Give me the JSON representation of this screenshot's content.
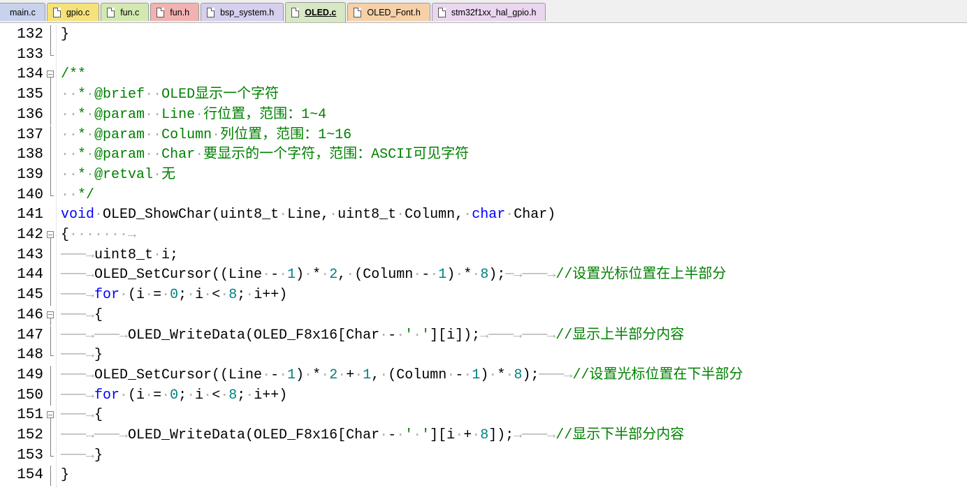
{
  "tabs": [
    {
      "label": "main.c",
      "color": "#c8d2ec"
    },
    {
      "label": "gpio.c",
      "color": "#f6e27a"
    },
    {
      "label": "fun.c",
      "color": "#d3e9b2"
    },
    {
      "label": "fun.h",
      "color": "#f2b2b2"
    },
    {
      "label": "bsp_system.h",
      "color": "#d6cfee"
    },
    {
      "label": "OLED.c",
      "color": "#d8e7c4",
      "active": true
    },
    {
      "label": "OLED_Font.h",
      "color": "#f6d0a8"
    },
    {
      "label": "stm32f1xx_hal_gpio.h",
      "color": "#ead6ee"
    }
  ],
  "colors": {
    "comment": "#008000",
    "keyword": "#0000ff",
    "number": "#008080",
    "whitespace_marker": "#b0b0b0"
  },
  "lines": [
    {
      "num": "132",
      "fold": "line",
      "tokens": [
        {
          "t": "}"
        }
      ]
    },
    {
      "num": "133",
      "fold": "end",
      "tokens": []
    },
    {
      "num": "134",
      "fold": "box",
      "tokens": [
        {
          "t": "/**",
          "c": "comment"
        }
      ]
    },
    {
      "num": "135",
      "fold": "line",
      "tokens": [
        {
          "t": "··",
          "c": "ws"
        },
        {
          "t": "*",
          "c": "comment"
        },
        {
          "t": "·",
          "c": "ws"
        },
        {
          "t": "@brief",
          "c": "comment"
        },
        {
          "t": "··",
          "c": "ws"
        },
        {
          "t": "OLED显示一个字符",
          "c": "comment"
        }
      ]
    },
    {
      "num": "136",
      "fold": "line",
      "tokens": [
        {
          "t": "··",
          "c": "ws"
        },
        {
          "t": "*",
          "c": "comment"
        },
        {
          "t": "·",
          "c": "ws"
        },
        {
          "t": "@param",
          "c": "comment"
        },
        {
          "t": "··",
          "c": "ws"
        },
        {
          "t": "Line",
          "c": "comment"
        },
        {
          "t": "·",
          "c": "ws"
        },
        {
          "t": "行位置，范围：1~4",
          "c": "comment"
        }
      ]
    },
    {
      "num": "137",
      "fold": "line",
      "tokens": [
        {
          "t": "··",
          "c": "ws"
        },
        {
          "t": "*",
          "c": "comment"
        },
        {
          "t": "·",
          "c": "ws"
        },
        {
          "t": "@param",
          "c": "comment"
        },
        {
          "t": "··",
          "c": "ws"
        },
        {
          "t": "Column",
          "c": "comment"
        },
        {
          "t": "·",
          "c": "ws"
        },
        {
          "t": "列位置，范围：1~16",
          "c": "comment"
        }
      ]
    },
    {
      "num": "138",
      "fold": "line",
      "tokens": [
        {
          "t": "··",
          "c": "ws"
        },
        {
          "t": "*",
          "c": "comment"
        },
        {
          "t": "·",
          "c": "ws"
        },
        {
          "t": "@param",
          "c": "comment"
        },
        {
          "t": "··",
          "c": "ws"
        },
        {
          "t": "Char",
          "c": "comment"
        },
        {
          "t": "·",
          "c": "ws"
        },
        {
          "t": "要显示的一个字符，范围：ASCII可见字符",
          "c": "comment"
        }
      ]
    },
    {
      "num": "139",
      "fold": "line",
      "tokens": [
        {
          "t": "··",
          "c": "ws"
        },
        {
          "t": "*",
          "c": "comment"
        },
        {
          "t": "·",
          "c": "ws"
        },
        {
          "t": "@retval",
          "c": "comment"
        },
        {
          "t": "·",
          "c": "ws"
        },
        {
          "t": "无",
          "c": "comment"
        }
      ]
    },
    {
      "num": "140",
      "fold": "end",
      "tokens": [
        {
          "t": "··",
          "c": "ws"
        },
        {
          "t": "*/",
          "c": "comment"
        }
      ]
    },
    {
      "num": "141",
      "fold": "",
      "tokens": [
        {
          "t": "void",
          "c": "kw"
        },
        {
          "t": "·",
          "c": "ws"
        },
        {
          "t": "OLED_ShowChar(uint8_t"
        },
        {
          "t": "·",
          "c": "ws"
        },
        {
          "t": "Line,"
        },
        {
          "t": "·",
          "c": "ws"
        },
        {
          "t": "uint8_t"
        },
        {
          "t": "·",
          "c": "ws"
        },
        {
          "t": "Column,"
        },
        {
          "t": "·",
          "c": "ws"
        },
        {
          "t": "char",
          "c": "kw"
        },
        {
          "t": "·",
          "c": "ws"
        },
        {
          "t": "Char)"
        }
      ]
    },
    {
      "num": "142",
      "fold": "box",
      "tokens": [
        {
          "t": "{"
        },
        {
          "t": "·······→",
          "c": "ws"
        }
      ]
    },
    {
      "num": "143",
      "fold": "line",
      "tokens": [
        {
          "t": "───→",
          "c": "ws"
        },
        {
          "t": "uint8_t"
        },
        {
          "t": "·",
          "c": "ws"
        },
        {
          "t": "i;"
        }
      ]
    },
    {
      "num": "144",
      "fold": "line",
      "tokens": [
        {
          "t": "───→",
          "c": "ws"
        },
        {
          "t": "OLED_SetCursor((Line"
        },
        {
          "t": "·",
          "c": "ws"
        },
        {
          "t": "-"
        },
        {
          "t": "·",
          "c": "ws"
        },
        {
          "t": "1",
          "c": "num"
        },
        {
          "t": ")"
        },
        {
          "t": "·",
          "c": "ws"
        },
        {
          "t": "*"
        },
        {
          "t": "·",
          "c": "ws"
        },
        {
          "t": "2",
          "c": "num"
        },
        {
          "t": ","
        },
        {
          "t": "·",
          "c": "ws"
        },
        {
          "t": "(Column"
        },
        {
          "t": "·",
          "c": "ws"
        },
        {
          "t": "-"
        },
        {
          "t": "·",
          "c": "ws"
        },
        {
          "t": "1",
          "c": "num"
        },
        {
          "t": ")"
        },
        {
          "t": "·",
          "c": "ws"
        },
        {
          "t": "*"
        },
        {
          "t": "·",
          "c": "ws"
        },
        {
          "t": "8",
          "c": "num"
        },
        {
          "t": ");"
        },
        {
          "t": "─→───→",
          "c": "ws"
        },
        {
          "t": "//设置光标位置在上半部分",
          "c": "comment"
        }
      ]
    },
    {
      "num": "145",
      "fold": "line",
      "tokens": [
        {
          "t": "───→",
          "c": "ws"
        },
        {
          "t": "for",
          "c": "kw"
        },
        {
          "t": "·",
          "c": "ws"
        },
        {
          "t": "(i"
        },
        {
          "t": "·",
          "c": "ws"
        },
        {
          "t": "="
        },
        {
          "t": "·",
          "c": "ws"
        },
        {
          "t": "0",
          "c": "num"
        },
        {
          "t": ";"
        },
        {
          "t": "·",
          "c": "ws"
        },
        {
          "t": "i"
        },
        {
          "t": "·",
          "c": "ws"
        },
        {
          "t": "<"
        },
        {
          "t": "·",
          "c": "ws"
        },
        {
          "t": "8",
          "c": "num"
        },
        {
          "t": ";"
        },
        {
          "t": "·",
          "c": "ws"
        },
        {
          "t": "i++)"
        }
      ]
    },
    {
      "num": "146",
      "fold": "box",
      "tokens": [
        {
          "t": "───→",
          "c": "ws"
        },
        {
          "t": "{"
        }
      ]
    },
    {
      "num": "147",
      "fold": "line",
      "tokens": [
        {
          "t": "───→───→",
          "c": "ws"
        },
        {
          "t": "OLED_WriteData(OLED_F8x16[Char"
        },
        {
          "t": "·",
          "c": "ws"
        },
        {
          "t": "-"
        },
        {
          "t": "·",
          "c": "ws"
        },
        {
          "t": "'",
          "c": "comment"
        },
        {
          "t": "·",
          "c": "ws"
        },
        {
          "t": "'",
          "c": "comment"
        },
        {
          "t": "][i]);"
        },
        {
          "t": "→───→───→",
          "c": "ws"
        },
        {
          "t": "//显示上半部分内容",
          "c": "comment"
        }
      ]
    },
    {
      "num": "148",
      "fold": "end",
      "tokens": [
        {
          "t": "───→",
          "c": "ws"
        },
        {
          "t": "}"
        }
      ]
    },
    {
      "num": "149",
      "fold": "line",
      "tokens": [
        {
          "t": "───→",
          "c": "ws"
        },
        {
          "t": "OLED_SetCursor((Line"
        },
        {
          "t": "·",
          "c": "ws"
        },
        {
          "t": "-"
        },
        {
          "t": "·",
          "c": "ws"
        },
        {
          "t": "1",
          "c": "num"
        },
        {
          "t": ")"
        },
        {
          "t": "·",
          "c": "ws"
        },
        {
          "t": "*"
        },
        {
          "t": "·",
          "c": "ws"
        },
        {
          "t": "2",
          "c": "num"
        },
        {
          "t": "·",
          "c": "ws"
        },
        {
          "t": "+"
        },
        {
          "t": "·",
          "c": "ws"
        },
        {
          "t": "1",
          "c": "num"
        },
        {
          "t": ","
        },
        {
          "t": "·",
          "c": "ws"
        },
        {
          "t": "(Column"
        },
        {
          "t": "·",
          "c": "ws"
        },
        {
          "t": "-"
        },
        {
          "t": "·",
          "c": "ws"
        },
        {
          "t": "1",
          "c": "num"
        },
        {
          "t": ")"
        },
        {
          "t": "·",
          "c": "ws"
        },
        {
          "t": "*"
        },
        {
          "t": "·",
          "c": "ws"
        },
        {
          "t": "8",
          "c": "num"
        },
        {
          "t": ");"
        },
        {
          "t": "───→",
          "c": "ws"
        },
        {
          "t": "//设置光标位置在下半部分",
          "c": "comment"
        }
      ]
    },
    {
      "num": "150",
      "fold": "line",
      "tokens": [
        {
          "t": "───→",
          "c": "ws"
        },
        {
          "t": "for",
          "c": "kw"
        },
        {
          "t": "·",
          "c": "ws"
        },
        {
          "t": "(i"
        },
        {
          "t": "·",
          "c": "ws"
        },
        {
          "t": "="
        },
        {
          "t": "·",
          "c": "ws"
        },
        {
          "t": "0",
          "c": "num"
        },
        {
          "t": ";"
        },
        {
          "t": "·",
          "c": "ws"
        },
        {
          "t": "i"
        },
        {
          "t": "·",
          "c": "ws"
        },
        {
          "t": "<"
        },
        {
          "t": "·",
          "c": "ws"
        },
        {
          "t": "8",
          "c": "num"
        },
        {
          "t": ";"
        },
        {
          "t": "·",
          "c": "ws"
        },
        {
          "t": "i++)"
        }
      ]
    },
    {
      "num": "151",
      "fold": "box",
      "tokens": [
        {
          "t": "───→",
          "c": "ws"
        },
        {
          "t": "{"
        }
      ]
    },
    {
      "num": "152",
      "fold": "line",
      "tokens": [
        {
          "t": "───→───→",
          "c": "ws"
        },
        {
          "t": "OLED_WriteData(OLED_F8x16[Char"
        },
        {
          "t": "·",
          "c": "ws"
        },
        {
          "t": "-"
        },
        {
          "t": "·",
          "c": "ws"
        },
        {
          "t": "'",
          "c": "comment"
        },
        {
          "t": "·",
          "c": "ws"
        },
        {
          "t": "'",
          "c": "comment"
        },
        {
          "t": "][i"
        },
        {
          "t": "·",
          "c": "ws"
        },
        {
          "t": "+"
        },
        {
          "t": "·",
          "c": "ws"
        },
        {
          "t": "8",
          "c": "num"
        },
        {
          "t": "]);"
        },
        {
          "t": "→───→",
          "c": "ws"
        },
        {
          "t": "//显示下半部分内容",
          "c": "comment"
        }
      ]
    },
    {
      "num": "153",
      "fold": "end",
      "tokens": [
        {
          "t": "───→",
          "c": "ws"
        },
        {
          "t": "}"
        }
      ]
    },
    {
      "num": "154",
      "fold": "line",
      "tokens": [
        {
          "t": "}"
        }
      ]
    }
  ]
}
